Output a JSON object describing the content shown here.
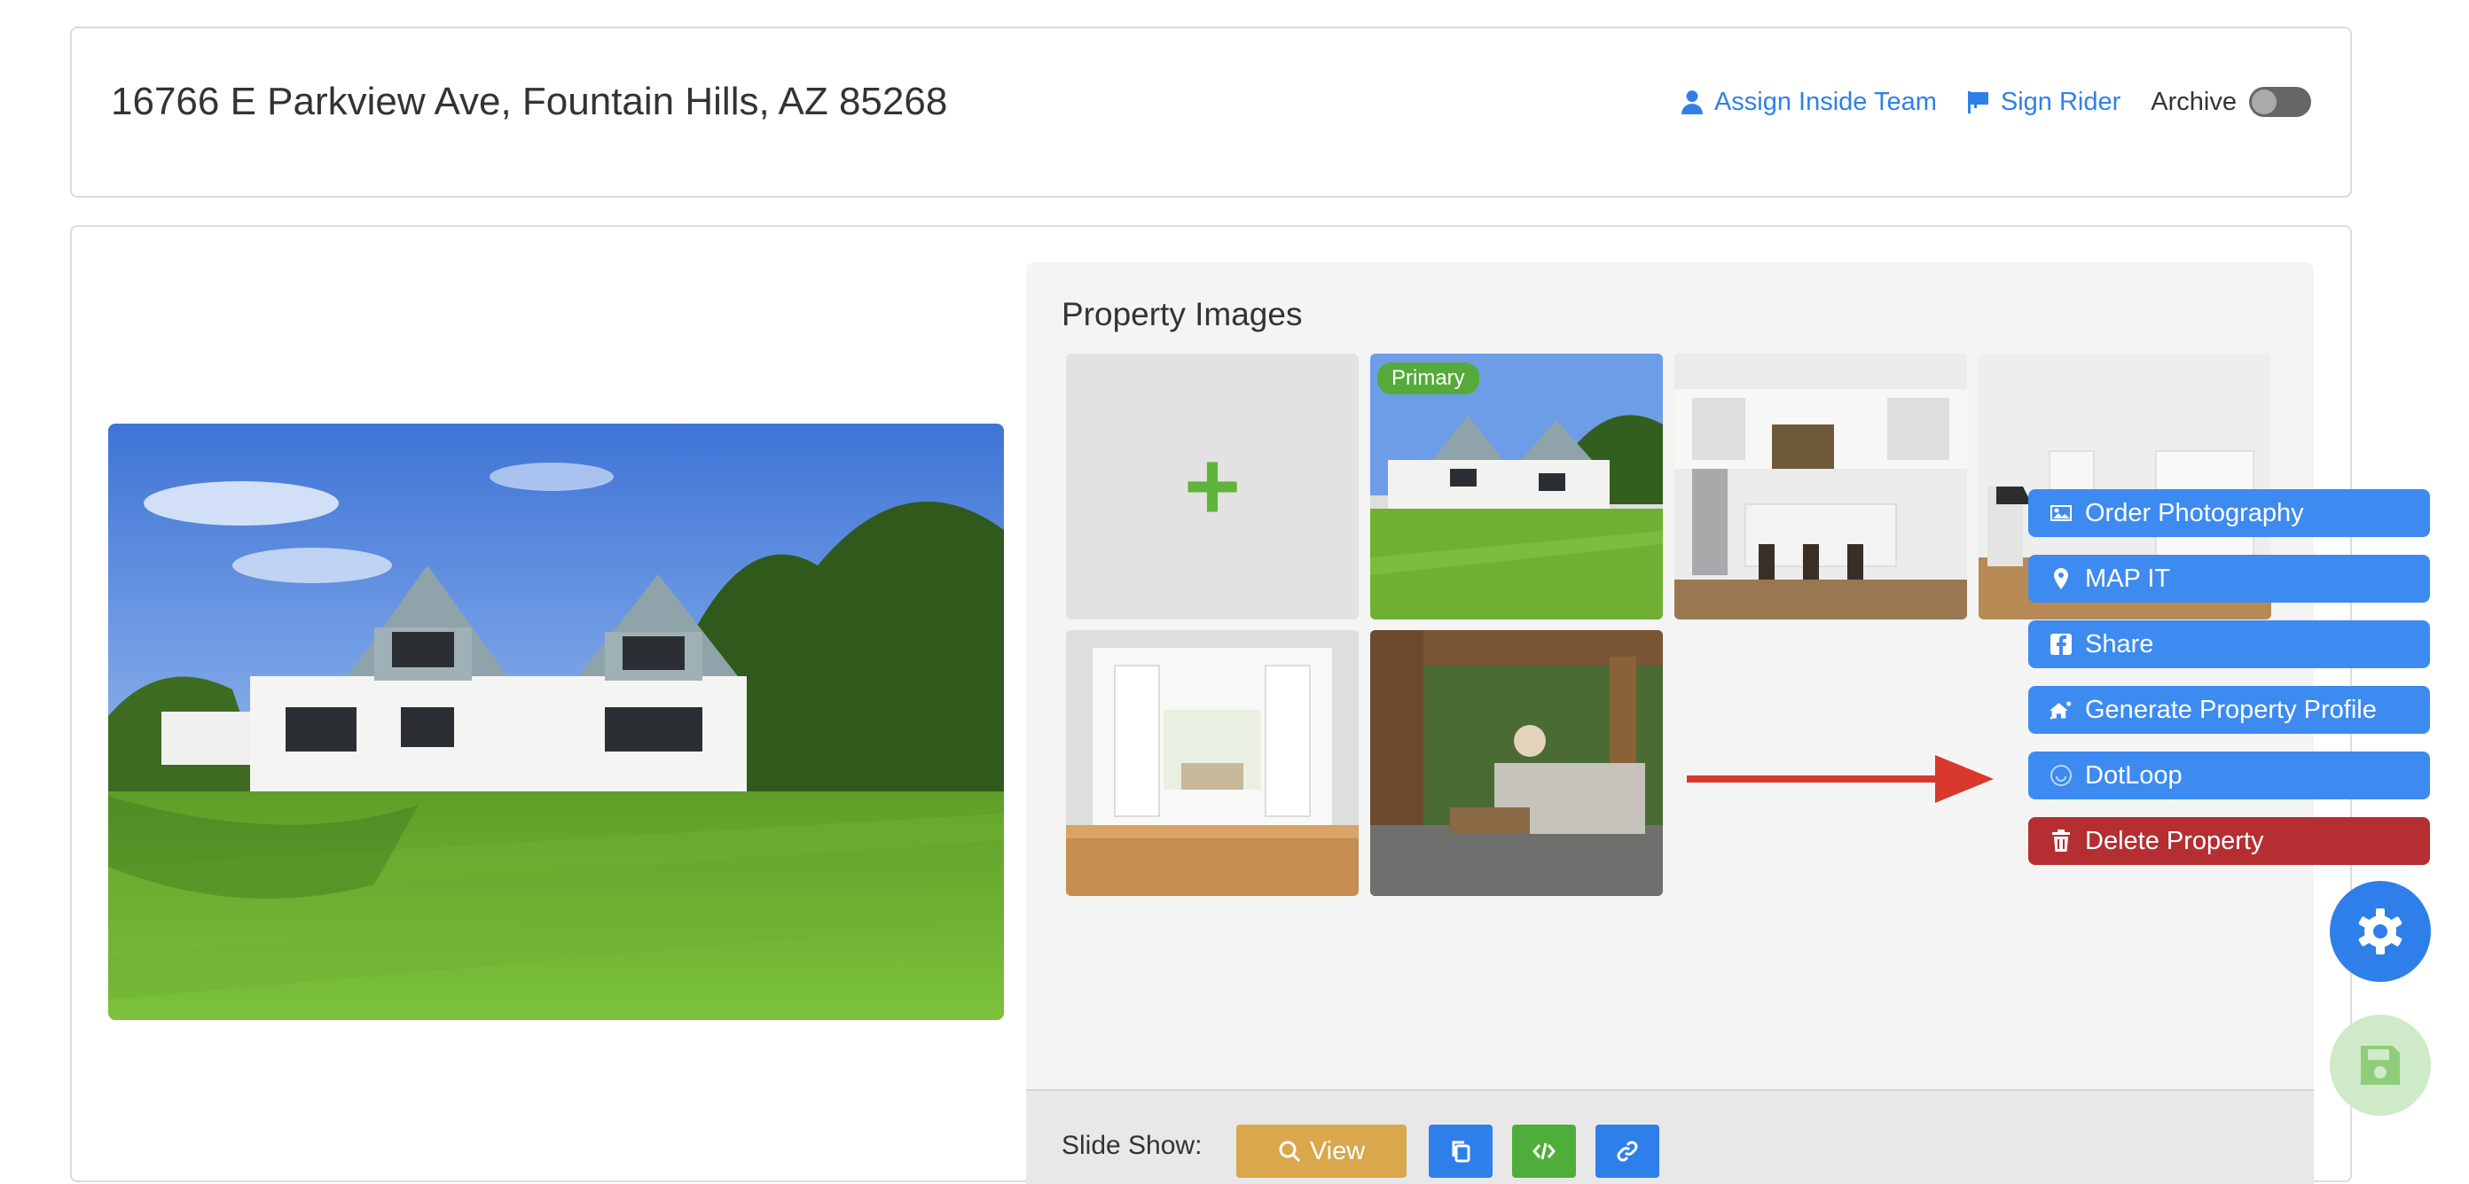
{
  "header": {
    "address": "16766 E Parkview Ave, Fountain Hills, AZ 85268",
    "assign_inside_team": "Assign Inside Team",
    "sign_rider": "Sign Rider",
    "archive_label": "Archive",
    "archive_on": false
  },
  "gallery": {
    "title": "Property Images",
    "primary_badge": "Primary",
    "add_icon": "plus-icon"
  },
  "slideshow": {
    "label": "Slide Show:",
    "view_label": "View"
  },
  "menu": {
    "order_photography": "Order Photography",
    "map_it": "MAP IT",
    "share": "Share",
    "generate_profile": "Generate Property Profile",
    "dotloop": "DotLoop",
    "delete_property": "Delete Property"
  },
  "colors": {
    "primary": "#2f7fea",
    "success": "#55aa3a",
    "warning": "#d9a84c",
    "danger": "#b52f32",
    "arrow": "#d9382c"
  }
}
